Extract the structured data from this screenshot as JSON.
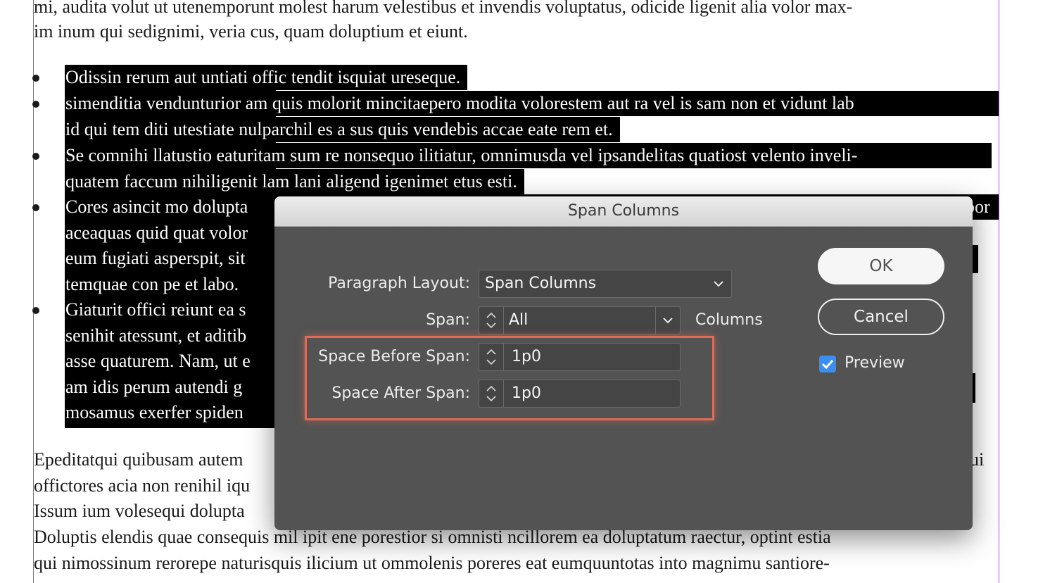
{
  "document": {
    "intro_lines": [
      "mi, audita volut ut utenemporunt molest harum velestibus et invendis voluptatus, odicide ligenit alia volor max-",
      "im inum qui sedignimi, veria cus, quam doluptium et eiunt."
    ],
    "bullets": [
      [
        "Odissin rerum aut untiati offic tendit isquiat ureseque."
      ],
      [
        "simenditia vendunturior am quis molorit mincitaepero modita volorestem aut ra vel is sam non et vidunt lab",
        "id qui tem diti utestiate nulparchil es a sus quis vendebis accae eate rem et."
      ],
      [
        "Se comnihi llatustio eaturitam sum re nonsequo ilitiatur, omnimusda vel ipsandelitas quatiost velento inveli-",
        "quatem faccum nihiligenit lam lani aligend igenimet etus esti."
      ],
      [
        "Cores asincit mo dolupta",
        "aceaquas quid quat volor",
        "eum fugiati asperspit, sit",
        "temquae con pe et labo."
      ],
      [
        "Giaturit offici reiunt ea s",
        "senihit atessunt, et aditib",
        "asse quaturem. Nam, ut e",
        "am idis perum autendi g",
        "mosamus exerfer spiden"
      ]
    ],
    "right_fragments": {
      "cores_end": "por",
      "epedita_end": "ui"
    },
    "outro_lines": [
      "Epeditatqui quibusam autem",
      "offictores acia non renihil iqu",
      "Issum ium volesequi dolupta",
      "Doluptis elendis quae consequis mil ipit ene porestior si omnisti ncillorem ea doluptatum raectur, optint estia",
      "qui nimossinum rerorepe naturisquis ilicium ut ommolenis poreres eat eumquuntotas into magnimu santiore-"
    ]
  },
  "dialog": {
    "title": "Span Columns",
    "paragraph_layout_label": "Paragraph Layout:",
    "paragraph_layout_value": "Span Columns",
    "span_label": "Span:",
    "span_value": "All",
    "span_unit": "Columns",
    "space_before_label": "Space Before Span:",
    "space_before_value": "1p0",
    "space_after_label": "Space After Span:",
    "space_after_value": "1p0",
    "ok_label": "OK",
    "cancel_label": "Cancel",
    "preview_label": "Preview",
    "preview_checked": true,
    "accent_color": "#3a8ef0",
    "highlight_color": "#e06c57"
  }
}
